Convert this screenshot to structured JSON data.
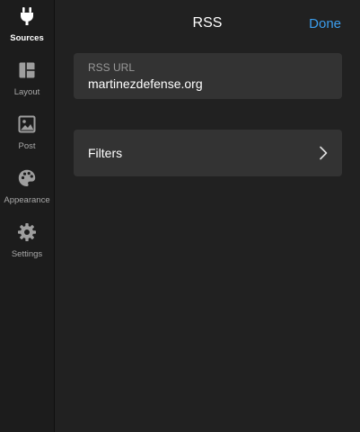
{
  "sidebar": {
    "items": [
      {
        "label": "Sources",
        "icon": "plug-icon",
        "active": true
      },
      {
        "label": "Layout",
        "icon": "layout-icon",
        "active": false
      },
      {
        "label": "Post",
        "icon": "image-icon",
        "active": false
      },
      {
        "label": "Appearance",
        "icon": "palette-icon",
        "active": false
      },
      {
        "label": "Settings",
        "icon": "gear-icon",
        "active": false
      }
    ]
  },
  "header": {
    "title": "RSS",
    "done_label": "Done"
  },
  "rss_field": {
    "label": "RSS URL",
    "value": "martinezdefense.org"
  },
  "filters_row": {
    "label": "Filters",
    "icon": "chevron-right-icon"
  },
  "colors": {
    "accent": "#3b9ded",
    "background": "#212121",
    "sidebar": "#1c1c1c",
    "card": "#333333"
  }
}
